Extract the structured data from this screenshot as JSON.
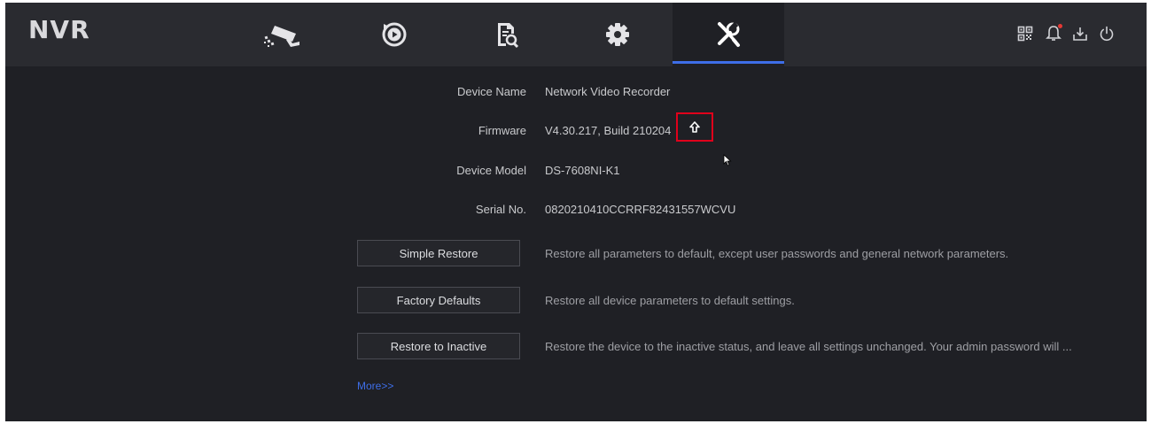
{
  "app": {
    "logo": "NVR"
  },
  "nav": {
    "tabs": [
      {
        "name": "live-view",
        "icon": "camera-icon",
        "active": false
      },
      {
        "name": "playback",
        "icon": "playback-icon",
        "active": false
      },
      {
        "name": "search",
        "icon": "file-search-icon",
        "active": false
      },
      {
        "name": "configuration",
        "icon": "gear-icon",
        "active": false
      },
      {
        "name": "maintenance",
        "icon": "wrench-screwdriver-icon",
        "active": true
      }
    ],
    "tools": [
      {
        "icon": "qr-code-icon"
      },
      {
        "icon": "bell-icon",
        "has_alert": true
      },
      {
        "icon": "download-icon"
      },
      {
        "icon": "power-icon"
      }
    ]
  },
  "info": {
    "device_name_label": "Device Name",
    "device_name_value": "Network Video Recorder",
    "firmware_label": "Firmware",
    "firmware_value": "V4.30.217, Build 210204",
    "device_model_label": "Device Model",
    "device_model_value": "DS-7608NI-K1",
    "serial_label": "Serial No.",
    "serial_value": "0820210410CCRRF82431557WCVU"
  },
  "actions": {
    "simple_restore_label": "Simple Restore",
    "simple_restore_desc": "Restore all parameters to default, except user passwords and general network parameters.",
    "factory_defaults_label": "Factory Defaults",
    "factory_defaults_desc": "Restore all device parameters to default settings.",
    "restore_inactive_label": "Restore to Inactive",
    "restore_inactive_desc": "Restore the device to the inactive status, and leave all settings unchanged. Your admin password will ...",
    "more_link": "More>>"
  },
  "colors": {
    "background": "#1f2025",
    "topbar": "#2a2b30",
    "accent": "#3e6ee8",
    "highlight": "#e0001b"
  }
}
